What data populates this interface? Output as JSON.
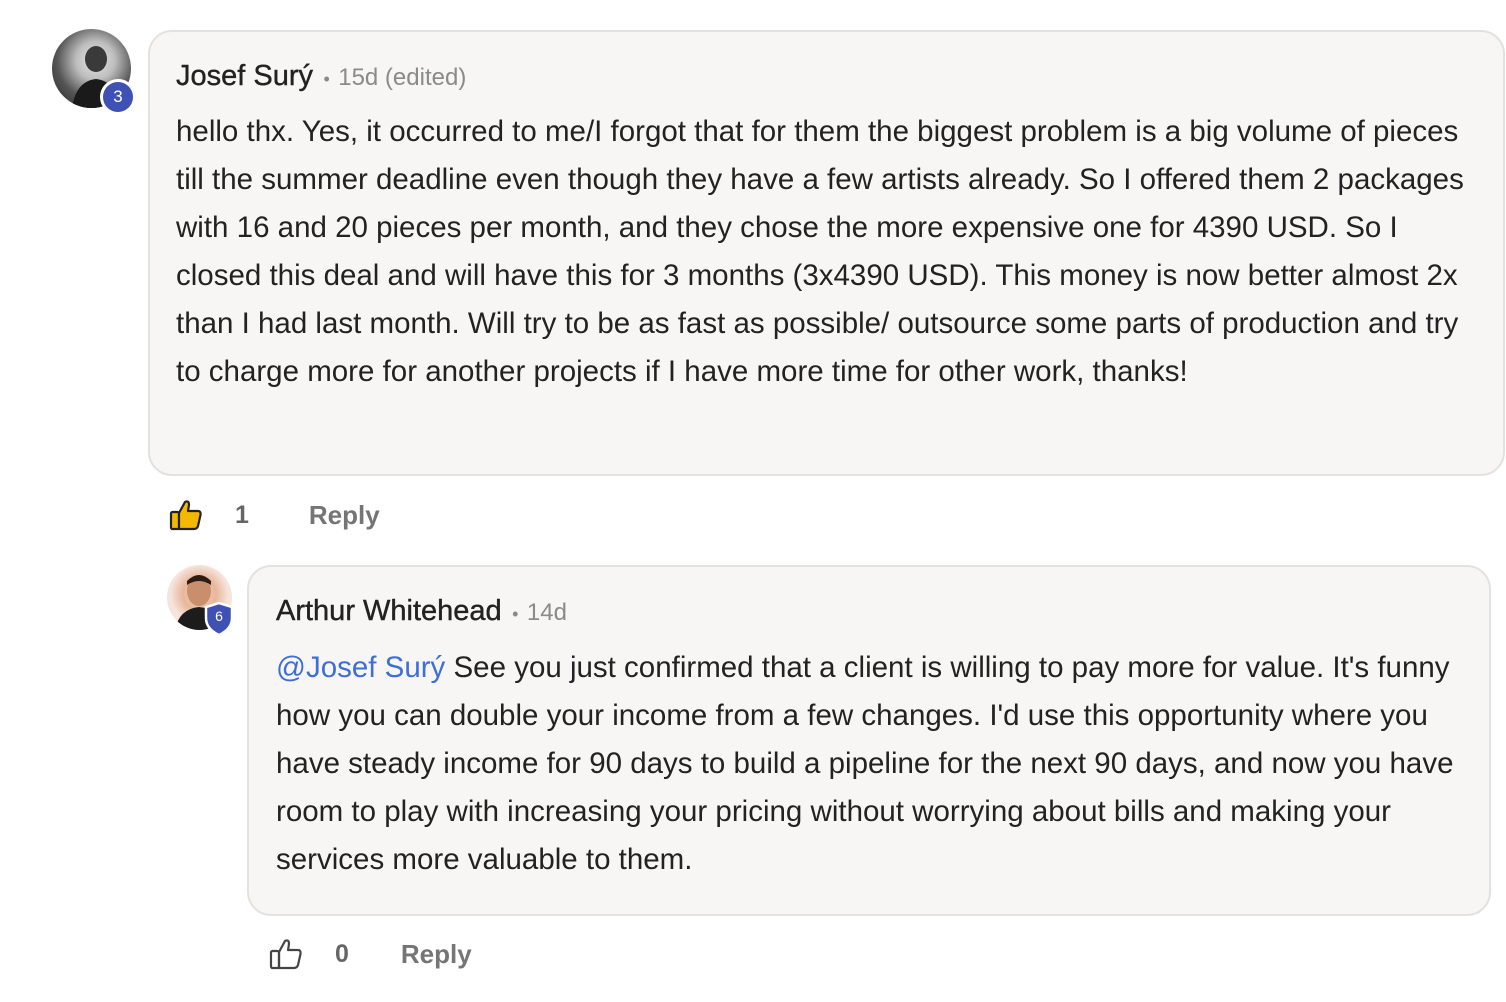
{
  "comments": [
    {
      "author": "Josef Surý",
      "separator": "•",
      "timestamp": "15d (edited)",
      "level": "3",
      "avatar_icon": "user-avatar",
      "body": "hello thx. Yes, it occurred to me/I forgot that for them the biggest problem is a big volume of pieces till the summer deadline even though they have a few artists already. So I offered them 2 packages with 16 and 20 pieces per month, and they chose the more expensive one for 4390 USD. So I closed this deal and will have this for 3 months (3x4390 USD). This money is now better almost 2x than I had last month. Will try to be as fast as possible/ outsource some parts of production and try to charge more for another projects if I have more time for other work, thanks!",
      "likes": "1",
      "liked": true,
      "reply_label": "Reply"
    },
    {
      "author": "Arthur Whitehead",
      "separator": "•",
      "timestamp": "14d",
      "level": "6",
      "avatar_icon": "user-avatar",
      "mention": "@Josef Surý",
      "body": " See you just confirmed that a client is willing to pay more for value. It's funny how you can double your income from a few changes. I'd use this opportunity where you have steady income for 90 days to build a pipeline for the next 90 days, and now you have room to play with increasing your pricing without worrying about bills and making your services more valuable to them.",
      "likes": "0",
      "liked": false,
      "reply_label": "Reply"
    }
  ],
  "colors": {
    "bubble_bg": "#f7f6f5",
    "bubble_border": "#e3e2e0",
    "badge": "#3f51b5",
    "mention": "#3d6fd6",
    "like_active": "#f5b800"
  }
}
